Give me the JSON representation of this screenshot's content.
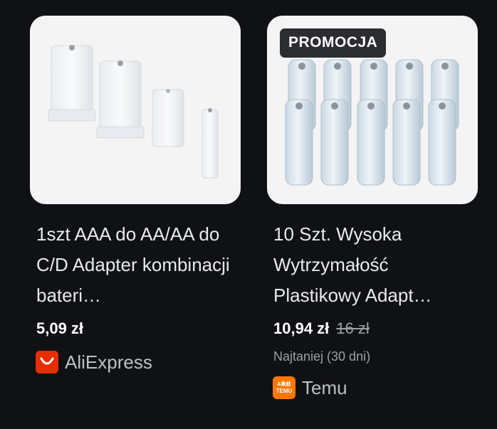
{
  "products": [
    {
      "title": "1szt AAA do AA/AA do C/D Adapter kombinacji bateri…",
      "price": "5,09 zł",
      "merchant": "AliExpress",
      "merchant_icon": "aliexpress-logo-icon"
    },
    {
      "badge": "PROMOCJA",
      "title": "10 Szt. Wysoka Wytrzymałość Plastikowy Adapt…",
      "price": "10,94 zł",
      "old_price": "16 zł",
      "note": "Najtaniej (30 dni)",
      "merchant": "Temu",
      "merchant_icon": "temu-logo-icon",
      "merchant_logo_text": [
        "&奥蛙",
        "TEMU"
      ]
    }
  ],
  "colors": {
    "background": "#101114",
    "aliexpress": "#e62e04",
    "temu": "#fb7701"
  }
}
